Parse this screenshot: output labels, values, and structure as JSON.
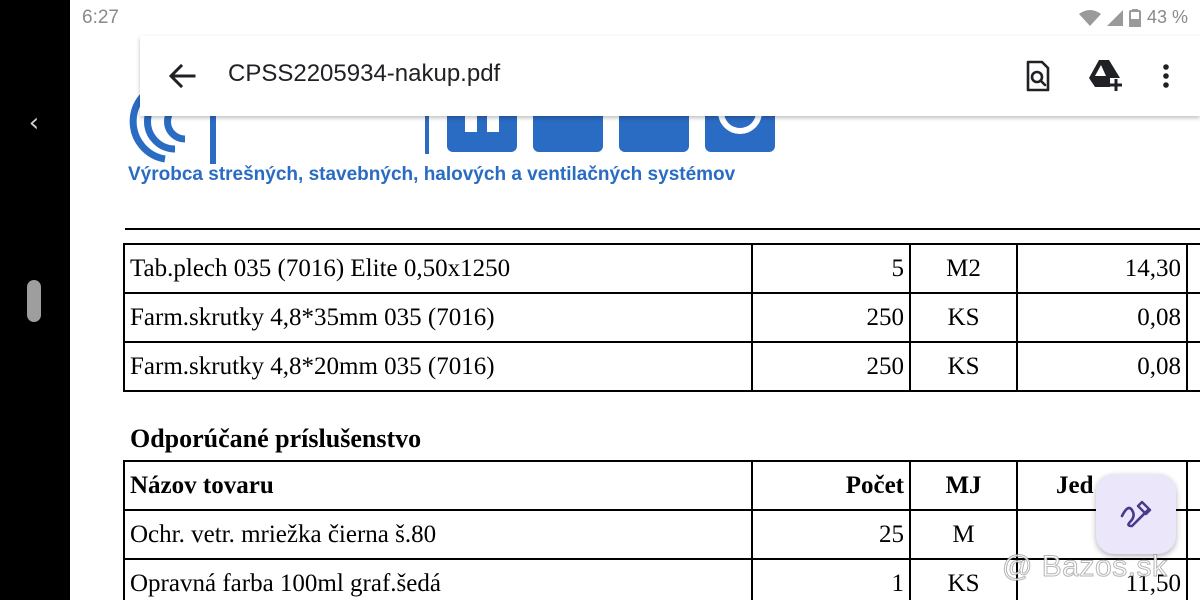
{
  "status_bar": {
    "time": "6:27",
    "battery": "43 %",
    "icons": [
      "wifi-icon",
      "signal-icon",
      "battery-icon"
    ]
  },
  "app_bar": {
    "title": "CPSS2205934-nakup.pdf",
    "icons": [
      "back-arrow-icon",
      "find-in-page-icon",
      "add-to-drive-icon",
      "more-vert-icon"
    ]
  },
  "document": {
    "logo_text": "Lindab",
    "tagline": "Výrobca strešných, stavebných, halových a ventilačných systémov",
    "table1": {
      "rows": [
        {
          "name": "Tab.plech 035 (7016) Elite 0,50x1250",
          "qty": "5",
          "mj": "M2",
          "price": "14,30"
        },
        {
          "name": "Farm.skrutky 4,8*35mm 035 (7016)",
          "qty": "250",
          "mj": "KS",
          "price": "0,08"
        },
        {
          "name": "Farm.skrutky 4,8*20mm 035 (7016)",
          "qty": "250",
          "mj": "KS",
          "price": "0,08"
        }
      ]
    },
    "section_title": "Odporúčané príslušenstvo",
    "table2": {
      "headers": {
        "name": "Názov tovaru",
        "qty": "Počet",
        "mj": "MJ",
        "price": "Jed"
      },
      "rows": [
        {
          "name": "Ochr. vetr. mriežka čierna š.80",
          "qty": "25",
          "mj": "M",
          "price": ""
        },
        {
          "name": "Opravná farba 100ml graf.šedá",
          "qty": "1",
          "mj": "KS",
          "price": "11,50"
        }
      ]
    }
  },
  "fab": {
    "icon": "edit-annotate-icon"
  },
  "watermark": "@ Bazos.sk",
  "colors": {
    "brand_blue": "#2a6bc3",
    "fab_bg": "#ece6fb",
    "fab_icon": "#4a3a8c"
  }
}
